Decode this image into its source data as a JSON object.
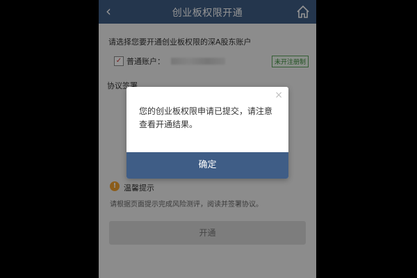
{
  "header": {
    "title": "创业板权限开通",
    "back_icon": "‹",
    "home_icon": "home-icon"
  },
  "main": {
    "prompt": "请选择您要开通创业板权限的深A股东账户",
    "account": {
      "label": "普通账户：",
      "status": "未开注册制",
      "checked": true
    },
    "sign_label": "协议签署",
    "tip": {
      "icon": "!",
      "title": "温馨提示",
      "text": "请根据页面提示完成风险测评，阅读并签署协议。"
    },
    "open_button": "开通"
  },
  "dialog": {
    "close_icon": "×",
    "message": "您的创业板权限申请已提交，请注意查看开通结果。",
    "confirm_button": "确定"
  },
  "colors": {
    "brand": "#3f5d86",
    "accent_green": "#3b8a3b",
    "warning": "#f0a030"
  }
}
